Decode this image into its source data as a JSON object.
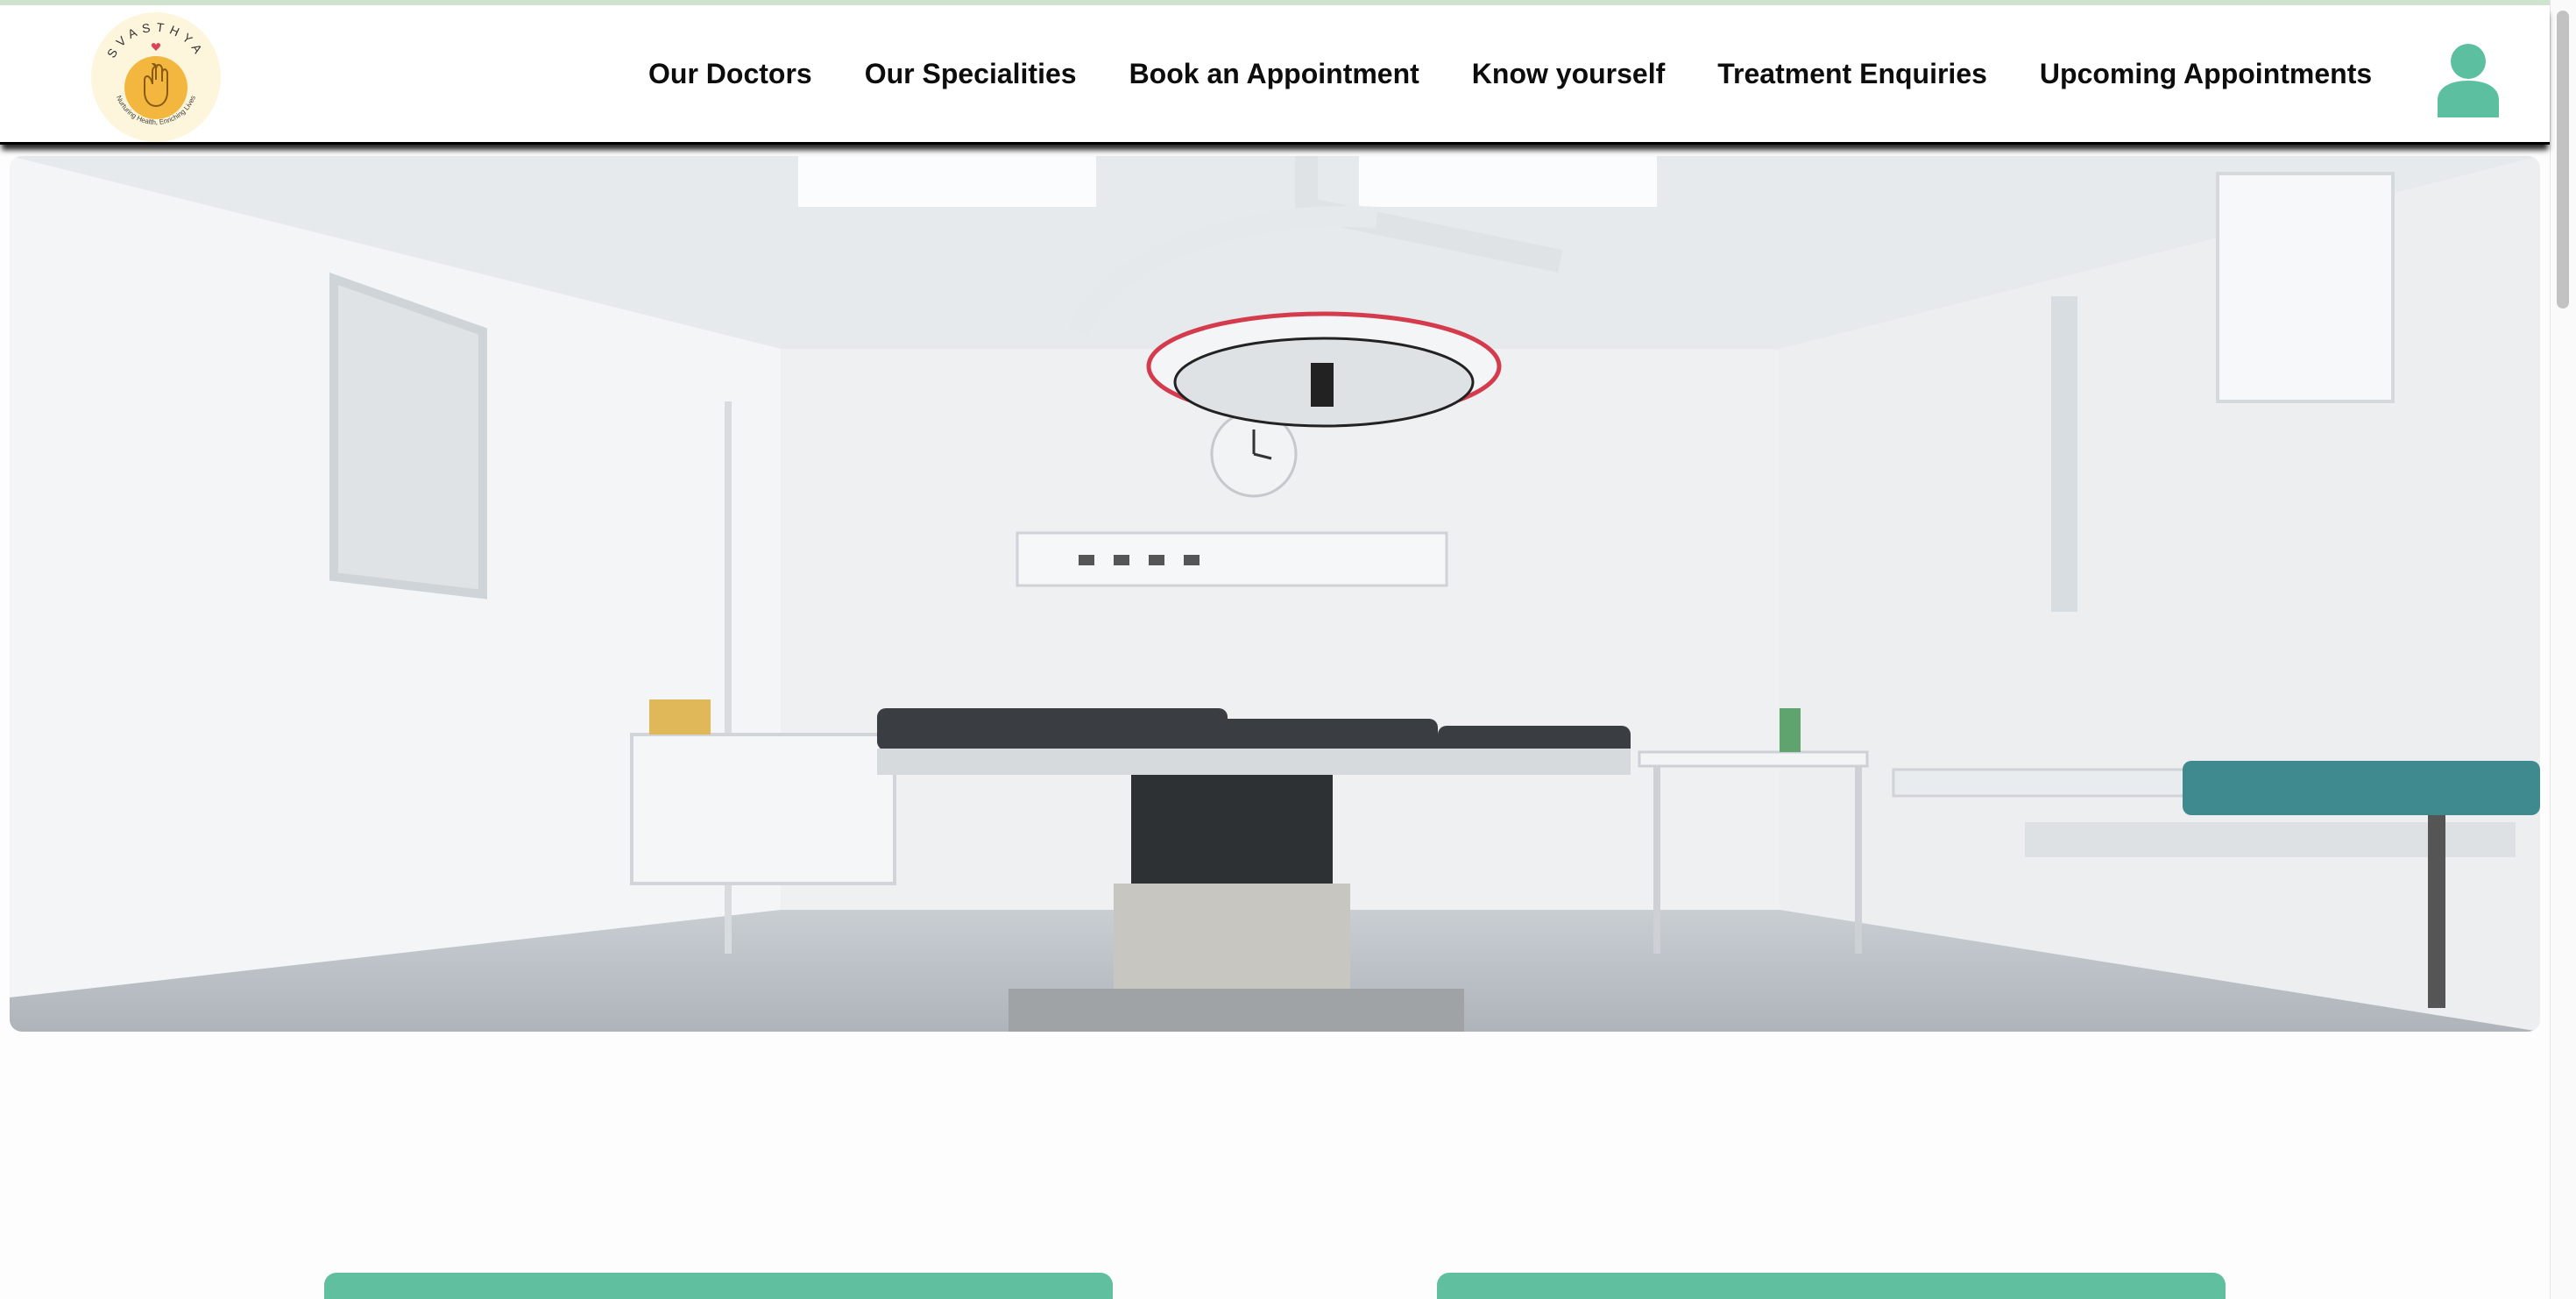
{
  "brand": {
    "logo_name": "SVASTHYA",
    "logo_tagline": "Nurturing Health, Enriching Lives"
  },
  "nav": {
    "items": [
      {
        "label": "Our Doctors"
      },
      {
        "label": "Our Specialities"
      },
      {
        "label": "Book an Appointment"
      },
      {
        "label": "Know yourself"
      },
      {
        "label": "Treatment Enquiries"
      },
      {
        "label": "Upcoming Appointments"
      }
    ],
    "account_icon": "user-icon"
  },
  "carousel": {
    "slide_count": 3,
    "active_index": 2
  },
  "colors": {
    "accent_teal": "#5fbf9f",
    "active_dot": "#1f4e79",
    "logo_yellow": "#f3b73f"
  }
}
